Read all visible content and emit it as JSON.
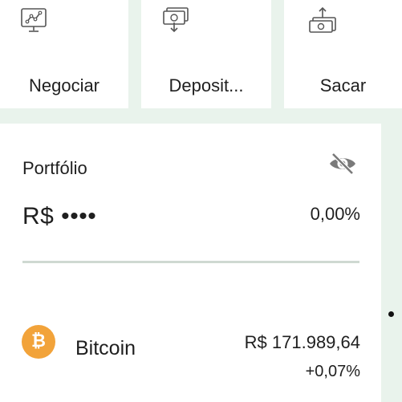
{
  "actions": [
    {
      "label": "Negociar",
      "icon": "trade-chart-icon"
    },
    {
      "label": "Deposit...",
      "icon": "deposit-icon"
    },
    {
      "label": "Sacar",
      "icon": "withdraw-icon"
    }
  ],
  "portfolio": {
    "title": "Portfólio",
    "value_masked": "R$ ••••",
    "change": "0,00%",
    "visibility_icon": "eye-off-icon"
  },
  "assets": [
    {
      "name": "Bitcoin",
      "symbol_glyph": "₿",
      "price": "R$ 171.989,64",
      "change": "+0,07%",
      "icon_color": "#f2a33a"
    }
  ]
}
